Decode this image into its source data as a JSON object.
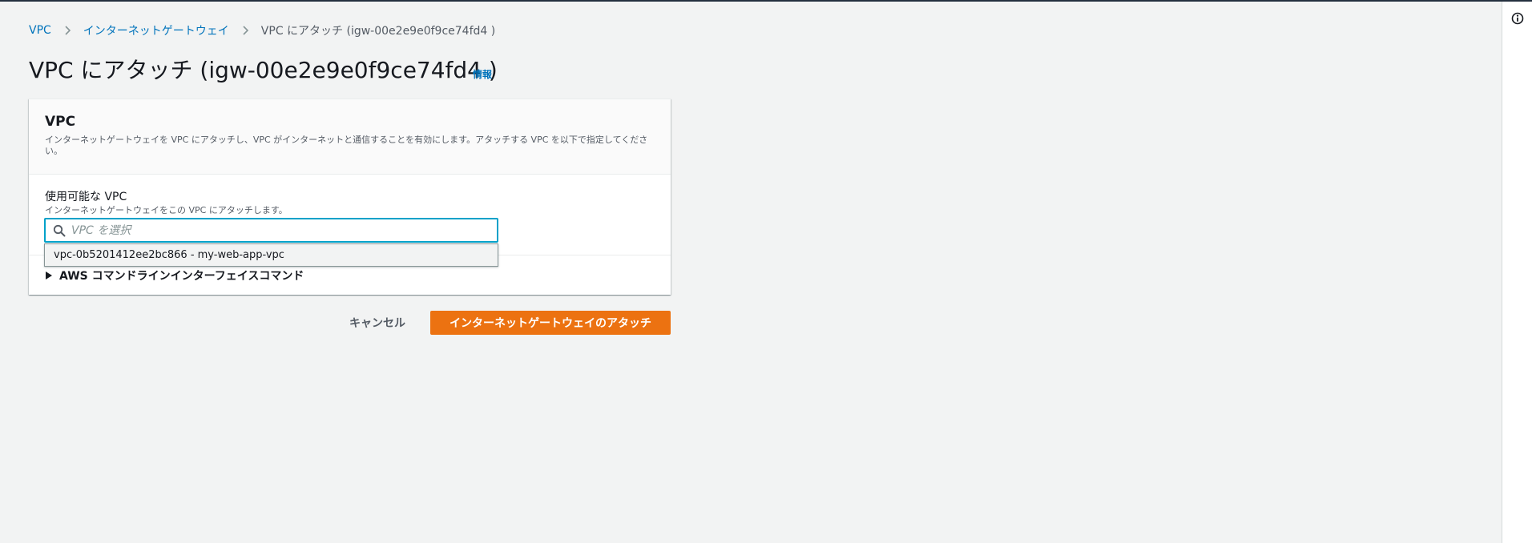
{
  "breadcrumb": {
    "items": [
      {
        "label": "VPC"
      },
      {
        "label": "インターネットゲートウェイ"
      },
      {
        "label": "VPC にアタッチ (igw-00e2e9e0f9ce74fd4 )"
      }
    ]
  },
  "page": {
    "title": "VPC にアタッチ (igw-00e2e9e0f9ce74fd4 )",
    "info_link": "情報"
  },
  "panel": {
    "title": "VPC",
    "description": "インターネットゲートウェイを VPC にアタッチし、VPC がインターネットと通信することを有効にします。アタッチする VPC を以下で指定してください。"
  },
  "field": {
    "label": "使用可能な VPC",
    "description": "インターネットゲートウェイをこの VPC にアタッチします。",
    "placeholder": "VPC を選択",
    "value": ""
  },
  "dropdown": {
    "options": [
      {
        "label": "vpc-0b5201412ee2bc866 - my-web-app-vpc"
      }
    ]
  },
  "cli": {
    "label": "AWS コマンドラインインターフェイスコマンド"
  },
  "actions": {
    "cancel_label": "キャンセル",
    "submit_label": "インターネットゲートウェイのアタッチ"
  },
  "icons": {
    "info_toggle": "info-circle-icon",
    "breadcrumb_separator": "chevron-right-icon",
    "search": "search-icon",
    "cli_caret": "caret-right-icon"
  },
  "colors": {
    "link": "#0073bb",
    "primary": "#ec7211",
    "focus": "#00a1c9",
    "background": "#f2f3f3"
  }
}
